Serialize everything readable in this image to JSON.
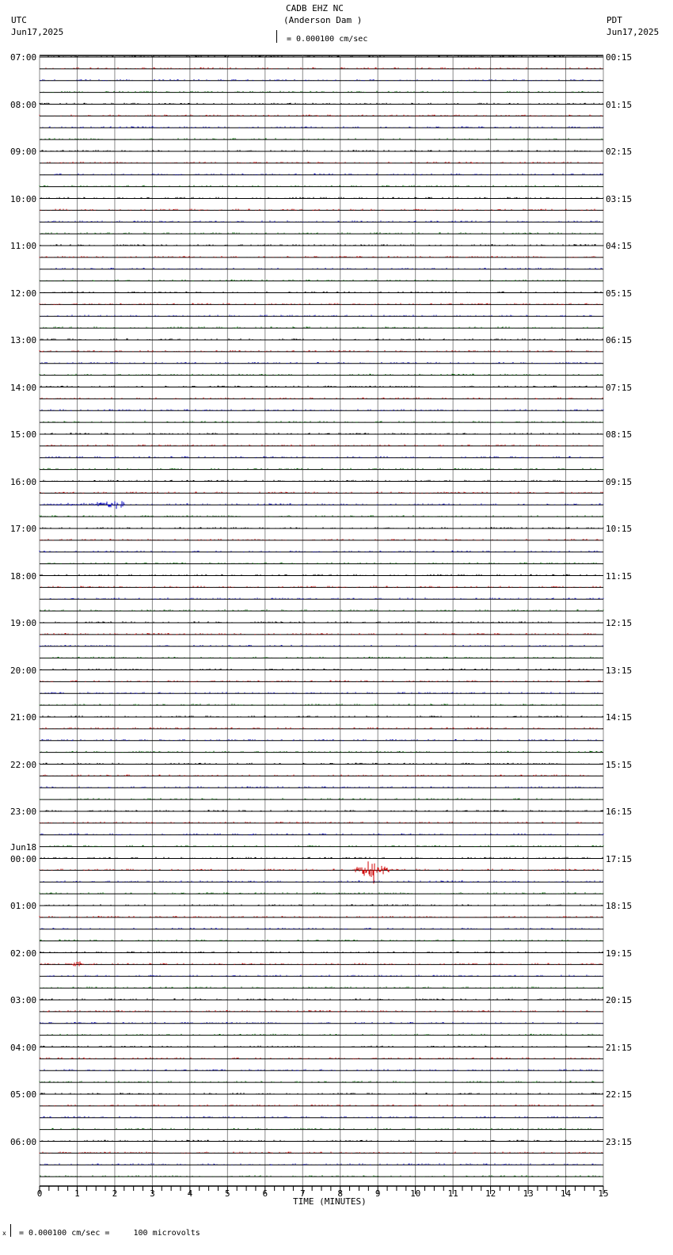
{
  "header": {
    "title_line1": "CADB EHZ NC",
    "title_line2": "(Anderson Dam )",
    "scale_text": "= 0.000100 cm/sec",
    "left_tz": "UTC",
    "left_date": "Jun17,2025",
    "right_tz": "PDT",
    "right_date": "Jun17,2025"
  },
  "footer": {
    "scale_note": "= 0.000100 cm/sec =     100 microvolts"
  },
  "chart_data": {
    "type": "line",
    "title": "CADB EHZ NC (Anderson Dam )",
    "xlabel": "TIME (MINUTES)",
    "xlim": [
      0,
      15
    ],
    "x_ticks": [
      "0",
      "1",
      "2",
      "3",
      "4",
      "5",
      "6",
      "7",
      "8",
      "9",
      "10",
      "11",
      "12",
      "13",
      "14",
      "15"
    ],
    "traces_per_hour": 4,
    "trace_colors": [
      "#000000",
      "#d00000",
      "#0000c0",
      "#007000"
    ],
    "left_labels": [
      "07:00",
      "08:00",
      "09:00",
      "10:00",
      "11:00",
      "12:00",
      "13:00",
      "14:00",
      "15:00",
      "16:00",
      "17:00",
      "18:00",
      "19:00",
      "20:00",
      "21:00",
      "22:00",
      "23:00",
      "00:00",
      "01:00",
      "02:00",
      "03:00",
      "04:00",
      "05:00",
      "06:00"
    ],
    "date_change_label": {
      "before_hour": "00:00",
      "text": "Jun18"
    },
    "right_labels": [
      "00:15",
      "01:15",
      "02:15",
      "03:15",
      "04:15",
      "05:15",
      "06:15",
      "07:15",
      "08:15",
      "09:15",
      "10:15",
      "11:15",
      "12:15",
      "13:15",
      "14:15",
      "15:15",
      "16:15",
      "17:15",
      "18:15",
      "19:15",
      "20:15",
      "21:15",
      "22:15",
      "23:15"
    ],
    "events": [
      {
        "hour": "00:00",
        "trace": 1,
        "start_min": 8.4,
        "end_min": 9.3,
        "peak_min": 8.85,
        "amplitude": 14
      },
      {
        "hour": "16:00",
        "trace": 2,
        "start_min": 0.05,
        "end_min": 2.25,
        "peak_min": 2.1,
        "amplitude": 4
      },
      {
        "hour": "02:00",
        "trace": 1,
        "start_min": 0.7,
        "end_min": 1.2,
        "peak_min": 1.0,
        "amplitude": 2.5
      }
    ]
  }
}
